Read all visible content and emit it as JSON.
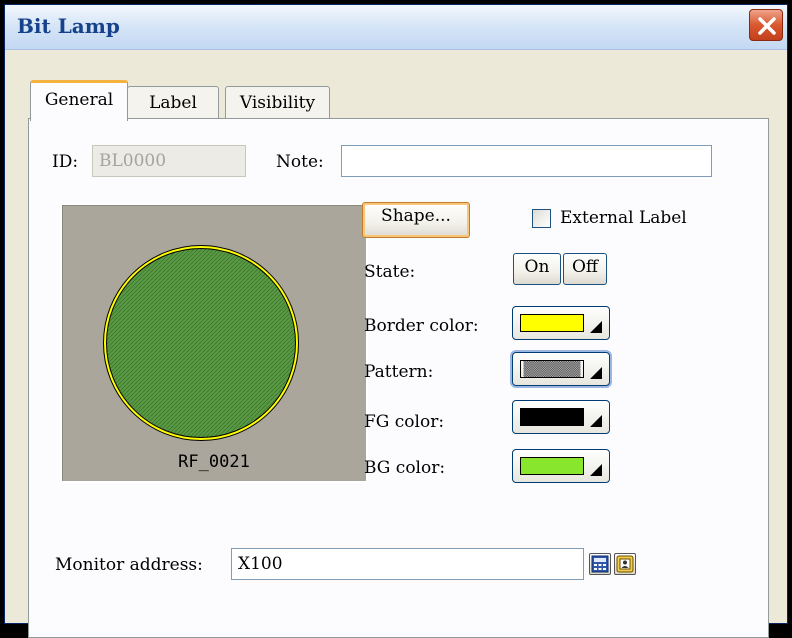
{
  "window": {
    "title": "Bit Lamp"
  },
  "tabs": [
    {
      "label": "General",
      "active": true
    },
    {
      "label": "Label",
      "active": false
    },
    {
      "label": "Visibility",
      "active": false
    }
  ],
  "general": {
    "id_label": "ID:",
    "id_value": "BL0000",
    "note_label": "Note:",
    "note_value": "",
    "preview_caption": "RF_0021",
    "shape_button": "Shape...",
    "external_label": {
      "label": "External Label",
      "checked": false
    },
    "state_label": "State:",
    "state_on": "On",
    "state_off": "Off",
    "border_color_label": "Border color:",
    "border_color": "#ffff00",
    "pattern_label": "Pattern:",
    "fg_color_label": "FG color:",
    "fg_color": "#000000",
    "bg_color_label": "BG color:",
    "bg_color": "#88e62d",
    "monitor_label": "Monitor address:",
    "monitor_value": "X100"
  },
  "colors": {
    "lamp_fill": "#5a9a44",
    "lamp_border": "#ffff00",
    "preview_bg": "#aaa69b"
  },
  "icons": [
    "close-icon",
    "calculator-icon",
    "address-book-icon",
    "dropdown-arrow-icon"
  ]
}
